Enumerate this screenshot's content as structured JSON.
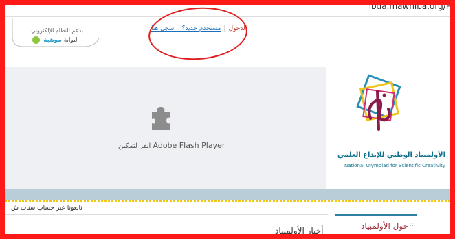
{
  "browser": {
    "url": "ibda.mawhiba.org/P"
  },
  "header": {
    "powered_text": "بدعم النظام الإلكتروني",
    "portal_prefix": "لبوابة",
    "portal_name": "موهبة",
    "login_label": "الدخول",
    "register_label": "مستخدم جديد؟ .. سجل هنا"
  },
  "flash": {
    "player_name": "Adobe Flash Player",
    "enable_hint": "انقر لتمكين"
  },
  "brand": {
    "title_ar": "الأولمبياد الوطني للإبداع العلمي",
    "title_en": "National Olympiad for Scientific Creativity"
  },
  "footer": {
    "follow_text": "تابعونا عبر حساب سناب ش",
    "about_label": "حول الأولمبياد",
    "news_heading": "أخبار الأولمبياد"
  },
  "colors": {
    "annotation": "#ff1a1a",
    "brand": "#12718d",
    "accent": "#f0c419"
  },
  "icons": [
    "puzzle-plugin-icon",
    "olympiad-logo-icon",
    "mawhiba-badge-icon"
  ]
}
